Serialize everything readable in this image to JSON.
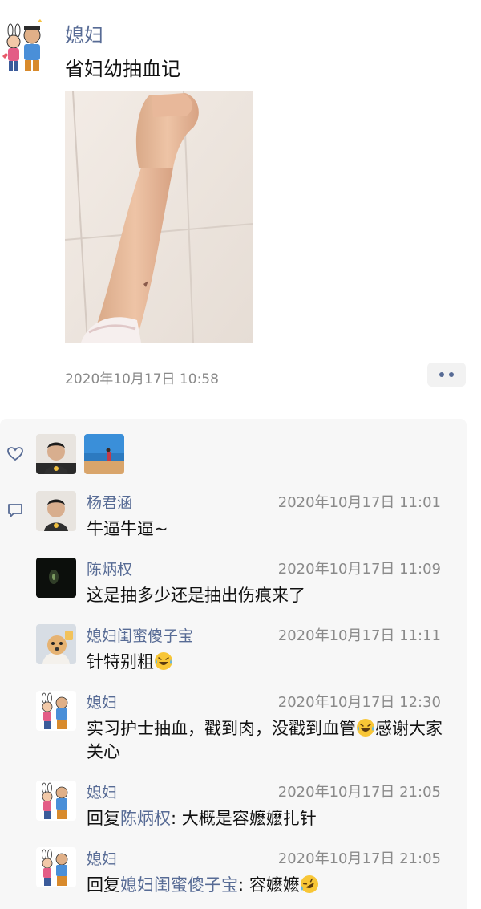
{
  "post": {
    "author": "媳妇",
    "text": "省妇幼抽血记",
    "time": "2020年10月17日 10:58"
  },
  "feedback": {
    "likes": [
      {
        "avatar": "man-avatar"
      },
      {
        "avatar": "beach-avatar"
      }
    ],
    "comments": [
      {
        "name": "杨君涵",
        "time": "2020年10月17日 11:01",
        "text": "牛逼牛逼~"
      },
      {
        "name": "陈炳权",
        "time": "2020年10月17日 11:09",
        "text": "这是抽多少还是抽出伤痕来了"
      },
      {
        "name": "媳妇闺蜜傻子宝",
        "time": "2020年10月17日 11:11",
        "text": "针特别粗",
        "emoji": "laughing-tears"
      },
      {
        "name": "媳妇",
        "time": "2020年10月17日 12:30",
        "text_before": "实习护士抽血，戳到肉，没戳到血管",
        "emoji": "laughing-tears",
        "text_after": "感谢大家关心"
      },
      {
        "name": "媳妇",
        "time": "2020年10月17日 21:05",
        "reply_prefix": "回复",
        "reply_to": "陈炳权",
        "text": ": 大概是容嬷嬷扎针"
      },
      {
        "name": "媳妇",
        "time": "2020年10月17日 21:05",
        "reply_prefix": "回复",
        "reply_to": "媳妇闺蜜傻子宝",
        "text": ": 容嬷嬷",
        "emoji": "rolling-laughing"
      }
    ]
  },
  "colors": {
    "link": "#576b95",
    "time": "#8a8a8a",
    "panel": "#f7f7f7"
  }
}
